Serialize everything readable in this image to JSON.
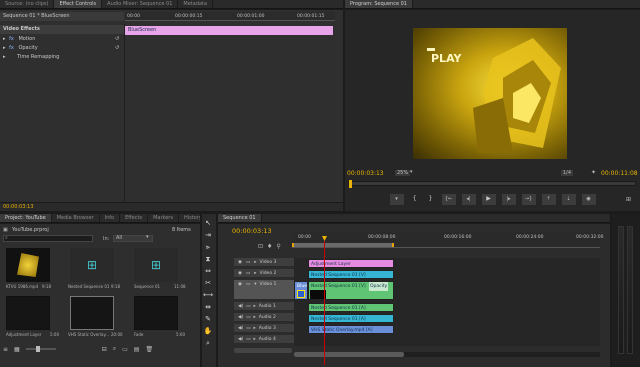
{
  "source_tabs": [
    "Source: (no clips)",
    "Effect Controls",
    "Audio Mixer: Sequence 01",
    "Metadata"
  ],
  "effect_controls": {
    "clip_path": "Sequence 01 * BlueScreen",
    "ruler": [
      "00:00",
      "00:00:00:15",
      "00:00:01:00",
      "00:00:01:15"
    ],
    "clip_bar_label": "BlueScreen",
    "header": "Video Effects",
    "effects": [
      "Motion",
      "Opacity",
      "Time Remapping"
    ],
    "fx_label": "fx",
    "timecode": "00:00:03:13"
  },
  "program": {
    "tab": "Program: Sequence 01",
    "timecode": "00:00:03:13",
    "zoom": "25%",
    "resolution": "1/4",
    "duration": "00:00:11:08",
    "video_text": "PLAY"
  },
  "project": {
    "tabs": [
      "Project: YouTube",
      "Media Browser",
      "Info",
      "Effects",
      "Markers",
      "History"
    ],
    "file": "YouTube.prproj",
    "items_count": "8 Items",
    "search_value": "",
    "in_label": "In:",
    "in_value": "All",
    "items": [
      {
        "name": "KTVU 1986.mp4",
        "dur": "9:18"
      },
      {
        "name": "Nested Sequence 01",
        "dur": "9:18"
      },
      {
        "name": "Sequence 01",
        "dur": "11:08"
      },
      {
        "name": "Adjustment Layer",
        "dur": "5:00"
      },
      {
        "name": "VHS Static Overlay...",
        "dur": "20:00"
      },
      {
        "name": "Fade",
        "dur": "5:00"
      }
    ]
  },
  "timeline": {
    "tab": "Sequence 01",
    "timecode": "00:00:03:13",
    "ruler": [
      "00:00",
      "00:00:08:00",
      "00:00:16:00",
      "00:00:24:00",
      "00:00:32:00"
    ],
    "tracks": [
      {
        "name": "Video 3",
        "type": "video"
      },
      {
        "name": "Video 2",
        "type": "video"
      },
      {
        "name": "Video 1",
        "type": "video"
      },
      {
        "name": "Audio 1",
        "type": "audio"
      },
      {
        "name": "Audio 2",
        "type": "audio"
      },
      {
        "name": "Audio 3",
        "type": "audio"
      },
      {
        "name": "Audio 4",
        "type": "audio"
      }
    ],
    "clips": {
      "adjustment": "Adjustment Layer",
      "nested_v2": "Nested Sequence 01 [V]",
      "blue": "Blue",
      "nested_v1": "Nested Sequence 01 [V]",
      "opacity": "Opacity",
      "nested_a1": "Nested Sequence 01 [A]",
      "nested_a2": "Nested Sequence 01 [A]",
      "vhs_a3": "VHS Static Overlay.mp4 [A]"
    }
  },
  "colors": {
    "timecode": "#e8b400",
    "clip_pink": "#e58ce0",
    "clip_cyan": "#35b6d4",
    "clip_green": "#5fc473",
    "clip_blue": "#6a8fd8",
    "clip_lavender": "#b7a0e8"
  }
}
